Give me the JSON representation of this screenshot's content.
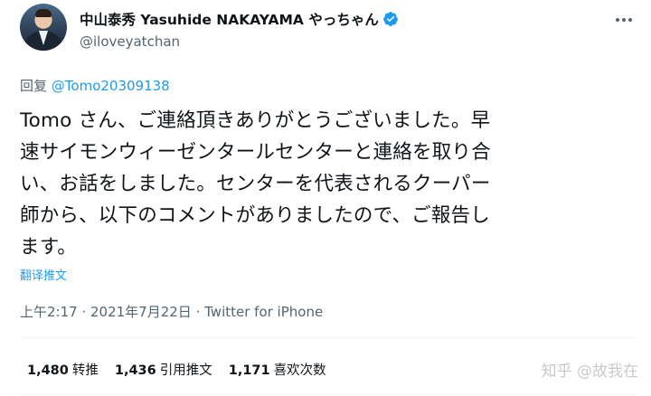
{
  "author": {
    "display_name": "中山泰秀 Yasuhide NAKAYAMA やっちゃん",
    "handle": "@iloveyatchan",
    "verified": true
  },
  "reply": {
    "prefix": "回复",
    "mention": "@Tomo20309138"
  },
  "tweet": {
    "lines": [
      "Tomo さん、ご連絡頂きありがとうございました。早",
      "速サイモンウィーゼンタールセンターと連絡を取り合",
      "い、お話をしました。センターを代表されるクーパー",
      "師から、以下のコメントがありましたので、ご報告し",
      "ます。"
    ]
  },
  "translate_label": "翻译推文",
  "meta": {
    "time": "上午2:17",
    "separator": " · ",
    "date": "2021年7月22日",
    "source": "Twitter for iPhone"
  },
  "stats": [
    {
      "count": "1,480",
      "label": "转推"
    },
    {
      "count": "1,436",
      "label": "引用推文"
    },
    {
      "count": "1,171",
      "label": "喜欢次数"
    }
  ],
  "watermark": "知乎 @故我在",
  "colors": {
    "accent": "#1d9bf0",
    "secondary_text": "#536471",
    "primary_text": "#0f1419"
  },
  "icons": [
    "verified-badge-icon",
    "more-options-icon"
  ]
}
